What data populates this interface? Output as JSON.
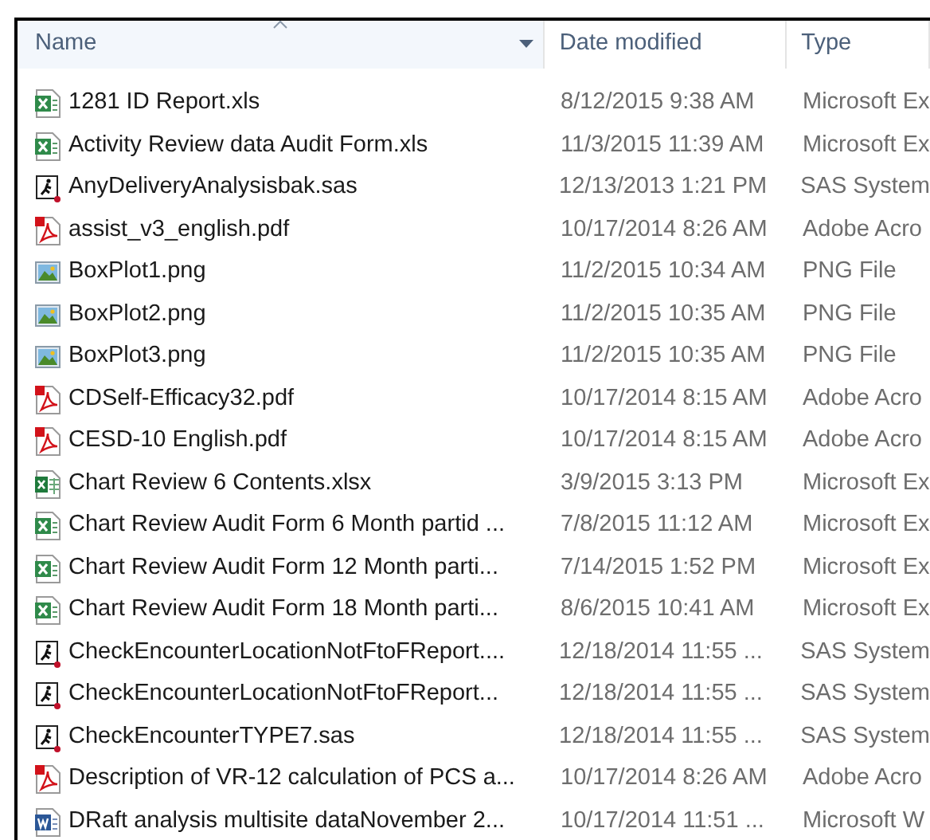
{
  "columns": [
    {
      "label": "Name",
      "sorted": true,
      "hovered": true
    },
    {
      "label": "Date modified",
      "sorted": false,
      "hovered": false
    },
    {
      "label": "Type",
      "sorted": false,
      "hovered": false
    }
  ],
  "files": [
    {
      "kind": "xls",
      "name": "1281 ID Report.xls",
      "date": "8/12/2015 9:38 AM",
      "type": "Microsoft Ex"
    },
    {
      "kind": "xls",
      "name": "Activity Review data Audit Form.xls",
      "date": "11/3/2015 11:39 AM",
      "type": "Microsoft Ex"
    },
    {
      "kind": "sas",
      "name": "AnyDeliveryAnalysisbak.sas",
      "date": "12/13/2013 1:21 PM",
      "type": "SAS System"
    },
    {
      "kind": "pdf",
      "name": "assist_v3_english.pdf",
      "date": "10/17/2014 8:26 AM",
      "type": "Adobe Acro"
    },
    {
      "kind": "png",
      "name": "BoxPlot1.png",
      "date": "11/2/2015 10:34 AM",
      "type": "PNG File"
    },
    {
      "kind": "png",
      "name": "BoxPlot2.png",
      "date": "11/2/2015 10:35 AM",
      "type": "PNG File"
    },
    {
      "kind": "png",
      "name": "BoxPlot3.png",
      "date": "11/2/2015 10:35 AM",
      "type": "PNG File"
    },
    {
      "kind": "pdf",
      "name": "CDSelf-Efficacy32.pdf",
      "date": "10/17/2014 8:15 AM",
      "type": "Adobe Acro"
    },
    {
      "kind": "pdf",
      "name": "CESD-10 English.pdf",
      "date": "10/17/2014 8:15 AM",
      "type": "Adobe Acro"
    },
    {
      "kind": "xlsx",
      "name": "Chart Review 6 Contents.xlsx",
      "date": "3/9/2015 3:13 PM",
      "type": "Microsoft Ex"
    },
    {
      "kind": "xls",
      "name": "Chart Review Audit Form 6 Month partid ...",
      "date": "7/8/2015 11:12 AM",
      "type": "Microsoft Ex"
    },
    {
      "kind": "xls",
      "name": "Chart Review Audit Form 12 Month parti...",
      "date": "7/14/2015 1:52 PM",
      "type": "Microsoft Ex"
    },
    {
      "kind": "xls",
      "name": "Chart Review Audit Form 18 Month parti...",
      "date": "8/6/2015 10:41 AM",
      "type": "Microsoft Ex"
    },
    {
      "kind": "sas",
      "name": "CheckEncounterLocationNotFtoFReport....",
      "date": "12/18/2014 11:55 ...",
      "type": "SAS System"
    },
    {
      "kind": "sas",
      "name": "CheckEncounterLocationNotFtoFReport...",
      "date": "12/18/2014 11:55 ...",
      "type": "SAS System"
    },
    {
      "kind": "sas",
      "name": "CheckEncounterTYPE7.sas",
      "date": "12/18/2014 11:55 ...",
      "type": "SAS System"
    },
    {
      "kind": "pdf",
      "name": "Description of VR-12 calculation of PCS a...",
      "date": "10/17/2014 8:26 AM",
      "type": "Adobe Acro"
    },
    {
      "kind": "doc",
      "name": "DRaft analysis multisite dataNovember 2...",
      "date": "10/17/2014 11:51 ...",
      "type": "Microsoft W"
    }
  ]
}
